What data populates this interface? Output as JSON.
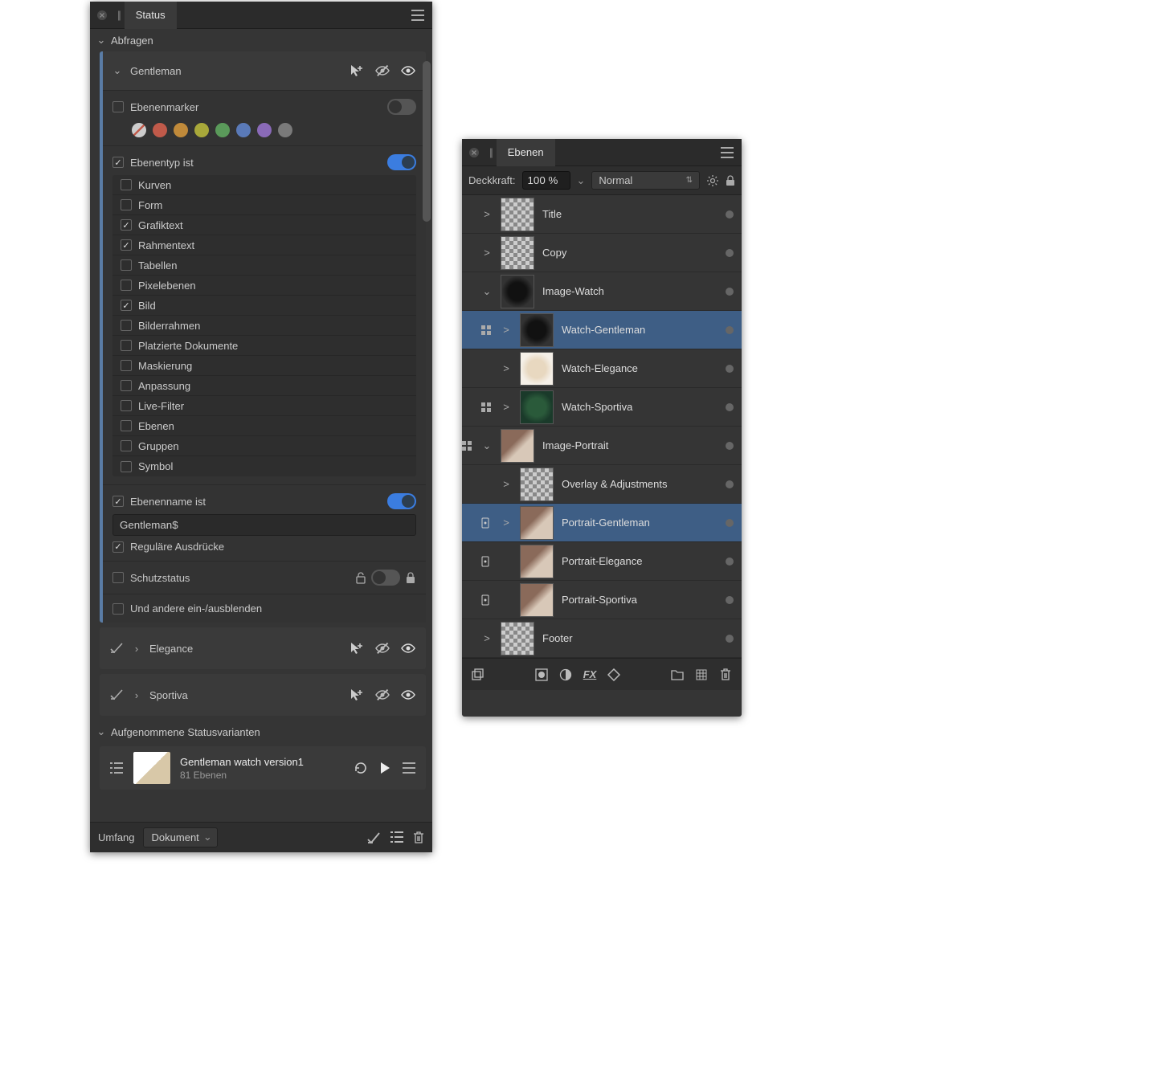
{
  "status_panel": {
    "tab": "Status",
    "abfragen_head": "Abfragen",
    "queries": [
      {
        "name": "Gentleman",
        "ebenenmarker": "Ebenenmarker",
        "ebenentyp_head": "Ebenentyp ist",
        "swatches": [
          "#888",
          "#c05a4a",
          "#c08a3a",
          "#a8a83a",
          "#5a9a5a",
          "#5a7ab8",
          "#8a6ab8",
          "#7a7a7a"
        ],
        "types": [
          {
            "label": "Kurven",
            "on": false
          },
          {
            "label": "Form",
            "on": false
          },
          {
            "label": "Grafiktext",
            "on": true
          },
          {
            "label": "Rahmentext",
            "on": true
          },
          {
            "label": "Tabellen",
            "on": false
          },
          {
            "label": "Pixelebenen",
            "on": false
          },
          {
            "label": "Bild",
            "on": true
          },
          {
            "label": "Bilderrahmen",
            "on": false
          },
          {
            "label": "Platzierte Dokumente",
            "on": false
          },
          {
            "label": "Maskierung",
            "on": false
          },
          {
            "label": "Anpassung",
            "on": false
          },
          {
            "label": "Live-Filter",
            "on": false
          },
          {
            "label": "Ebenen",
            "on": false
          },
          {
            "label": "Gruppen",
            "on": false
          },
          {
            "label": "Symbol",
            "on": false
          }
        ],
        "ebenenname_head": "Ebenenname ist",
        "name_value": "Gentleman$",
        "regex_label": "Reguläre Ausdrücke",
        "schutzstatus": "Schutzstatus",
        "andere": "Und andere ein-/ausblenden"
      }
    ],
    "mini_queries": [
      "Elegance",
      "Sportiva"
    ],
    "snapshots_head": "Aufgenommene Statusvarianten",
    "snapshot": {
      "title": "Gentleman watch version1",
      "sub": "81 Ebenen"
    },
    "footer": {
      "umfang": "Umfang",
      "scope": "Dokument"
    }
  },
  "layers_panel": {
    "tab": "Ebenen",
    "deckkraft_label": "Deckkraft:",
    "opacity": "100 %",
    "blend": "Normal",
    "rows": [
      {
        "name": "Title",
        "depth": 0,
        "exp": ">",
        "thumb": "check",
        "sel": false
      },
      {
        "name": "Copy",
        "depth": 0,
        "exp": ">",
        "thumb": "check",
        "sel": false
      },
      {
        "name": "Image-Watch",
        "depth": 0,
        "exp": "v",
        "thumb": "dark",
        "sel": false
      },
      {
        "name": "Watch-Gentleman",
        "depth": 1,
        "exp": ">",
        "thumb": "dark",
        "sel": true,
        "badge": true
      },
      {
        "name": "Watch-Elegance",
        "depth": 1,
        "exp": ">",
        "thumb": "light",
        "sel": false
      },
      {
        "name": "Watch-Sportiva",
        "depth": 1,
        "exp": ">",
        "thumb": "green",
        "sel": false,
        "badge": true
      },
      {
        "name": "Image-Portrait",
        "depth": 0,
        "exp": "v",
        "thumb": "photo",
        "sel": false,
        "badge": true
      },
      {
        "name": "Overlay & Adjustments",
        "depth": 1,
        "exp": ">",
        "thumb": "check",
        "sel": false
      },
      {
        "name": "Portrait-Gentleman",
        "depth": 1,
        "exp": ">",
        "thumb": "photo",
        "sel": true,
        "badge2": true
      },
      {
        "name": "Portrait-Elegance",
        "depth": 1,
        "exp": "",
        "thumb": "photo",
        "sel": false,
        "badge2": true
      },
      {
        "name": "Portrait-Sportiva",
        "depth": 1,
        "exp": "",
        "thumb": "photo",
        "sel": false,
        "badge2": true
      },
      {
        "name": "Footer",
        "depth": 0,
        "exp": ">",
        "thumb": "check",
        "sel": false
      }
    ]
  }
}
